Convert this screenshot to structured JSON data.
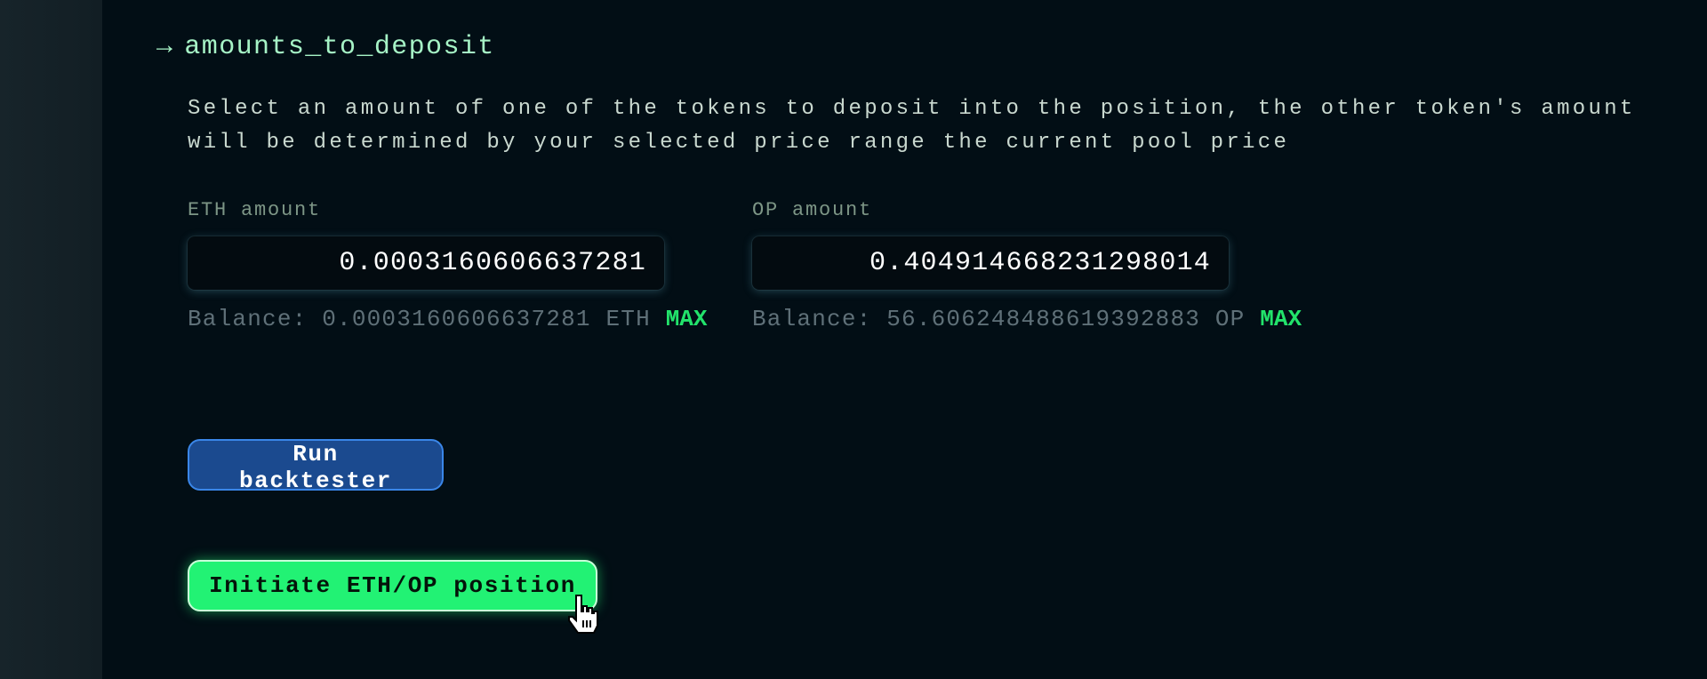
{
  "section": {
    "arrow_icon": "right-arrow",
    "title": "amounts_to_deposit",
    "description_lines": [
      "Select an amount of one of the tokens to deposit into the position, the other token's amount",
      "will be determined by your selected price range the current pool price"
    ]
  },
  "eth": {
    "label": "ETH amount",
    "value": "0.0003160606637281",
    "balance_text": "Balance: 0.0003160606637281 ETH",
    "max_label": "MAX"
  },
  "op": {
    "label": "OP amount",
    "value": "0.404914668231298014",
    "balance_text": "Balance: 56.606248488619392883 OP",
    "max_label": "MAX"
  },
  "buttons": {
    "backtest": "Run backtester",
    "initiate": "Initiate ETH/OP position"
  },
  "colors": {
    "background": "#020e15",
    "heading": "#a6f3c6",
    "max": "#22e36b",
    "primary_button": "#22f274",
    "secondary_button": "#1b4a8f"
  }
}
